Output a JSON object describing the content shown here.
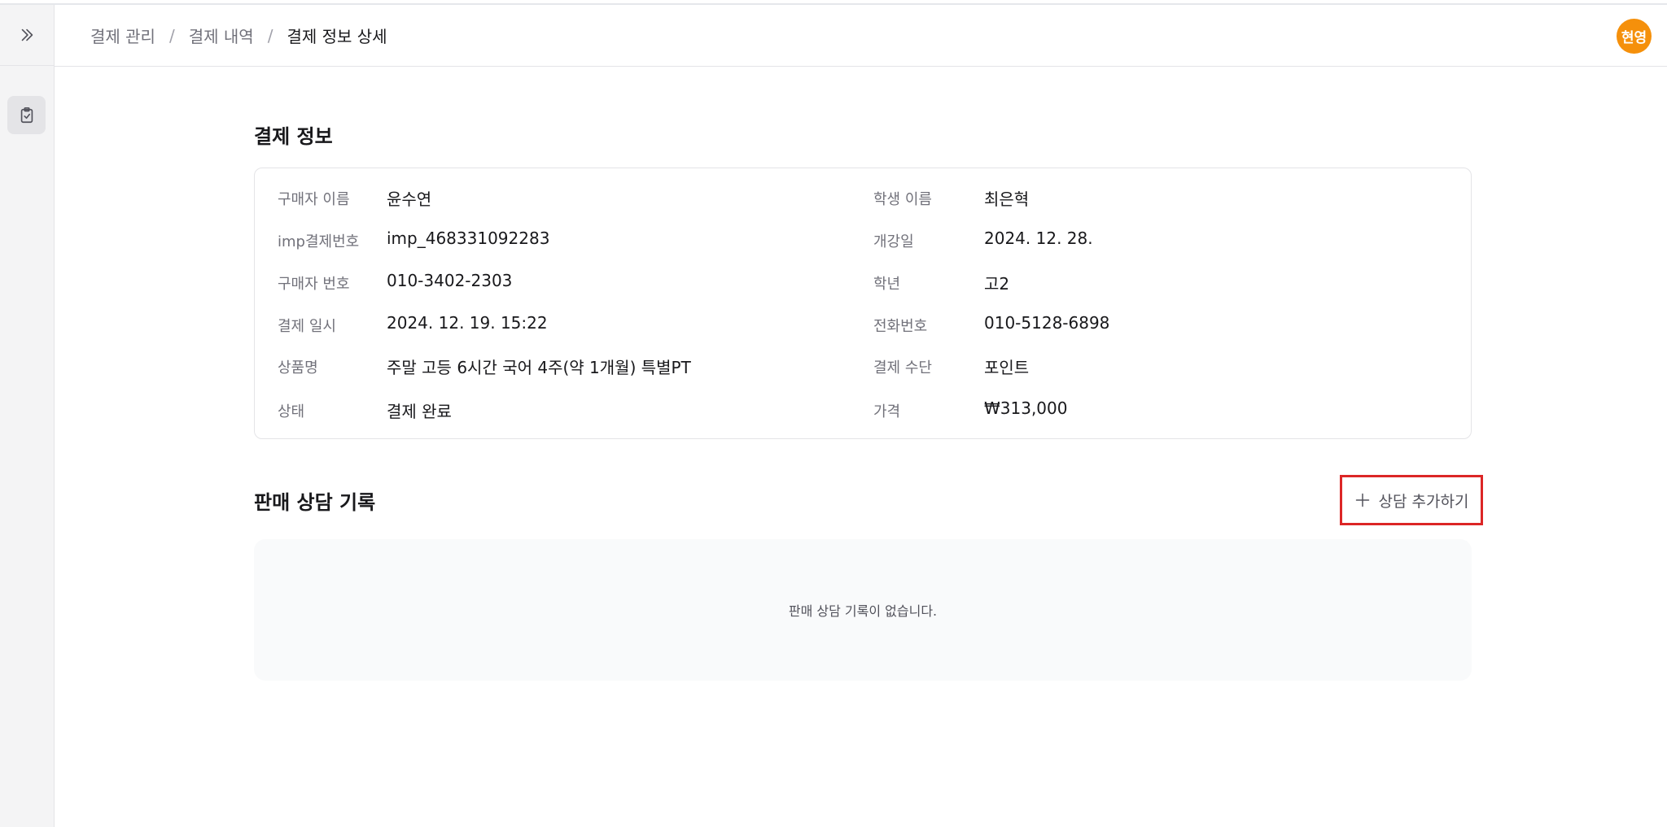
{
  "header": {
    "breadcrumb": [
      "결제 관리",
      "결제 내역",
      "결제 정보 상세"
    ],
    "separator": "/",
    "avatar_text": "현영"
  },
  "sidebar": {
    "toggle_icon": "chevrons-right-icon",
    "items": [
      {
        "icon": "clipboard-check-icon"
      }
    ]
  },
  "payment_info": {
    "title": "결제 정보",
    "left": [
      {
        "label": "구매자 이름",
        "value": "윤수연"
      },
      {
        "label": "imp결제번호",
        "value": "imp_468331092283"
      },
      {
        "label": "구매자 번호",
        "value": "010-3402-2303"
      },
      {
        "label": "결제 일시",
        "value": "2024. 12. 19. 15:22"
      },
      {
        "label": "상품명",
        "value": "주말 고등 6시간 국어 4주(약 1개월) 특별PT"
      },
      {
        "label": "상태",
        "value": "결제 완료"
      }
    ],
    "right": [
      {
        "label": "학생 이름",
        "value": "최은혁"
      },
      {
        "label": "개강일",
        "value": "2024. 12. 28."
      },
      {
        "label": "학년",
        "value": "고2"
      },
      {
        "label": "전화번호",
        "value": "010-5128-6898"
      },
      {
        "label": "결제 수단",
        "value": "포인트"
      },
      {
        "label": "가격",
        "value": "₩313,000"
      }
    ]
  },
  "consult": {
    "title": "판매 상담 기록",
    "add_button_label": "상담 추가하기",
    "empty_text": "판매 상담 기록이 없습니다."
  },
  "colors": {
    "accent_avatar": "#f5900b",
    "highlight_border": "#dc2626"
  }
}
